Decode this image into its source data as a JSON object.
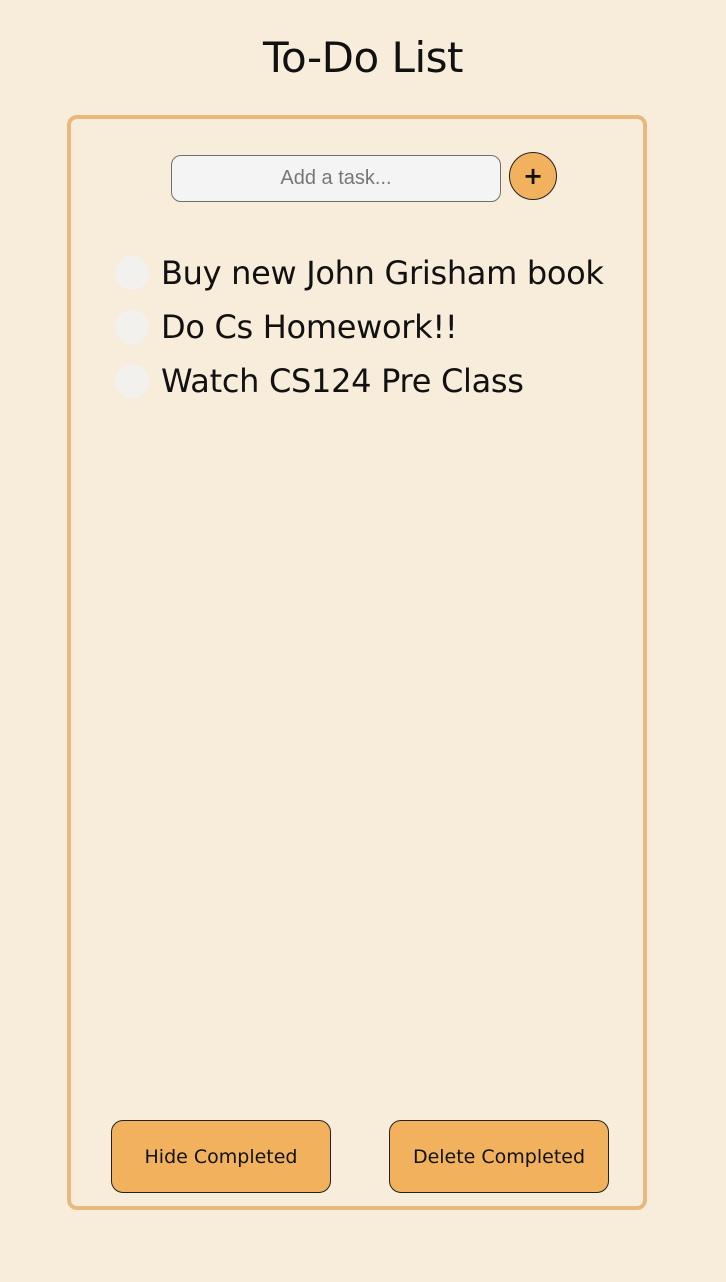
{
  "app": {
    "title": "To-Do List"
  },
  "input": {
    "placeholder": "Add a task...",
    "value": ""
  },
  "add_button": {
    "label": "+"
  },
  "tasks": [
    {
      "text": "Buy new John Grisham book",
      "completed": false
    },
    {
      "text": "Do Cs Homework!!",
      "completed": false
    },
    {
      "text": "Watch CS124 Pre Class",
      "completed": false
    }
  ],
  "footer": {
    "hide_label": "Hide Completed",
    "delete_label": "Delete Completed"
  },
  "colors": {
    "background": "#f8ecdb",
    "card_border": "#e8b97c",
    "accent": "#f2b15c",
    "checkbox": "#f3f1ee"
  }
}
